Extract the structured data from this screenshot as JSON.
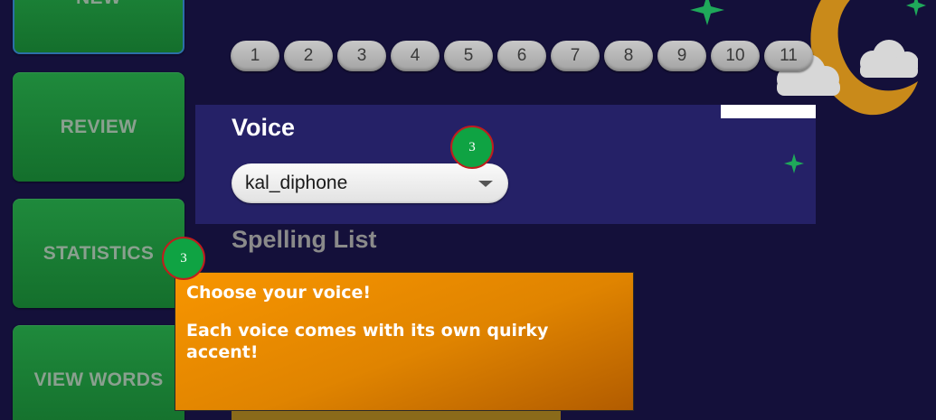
{
  "sidebar": {
    "items": [
      {
        "label": "NEW"
      },
      {
        "label": "REVIEW"
      },
      {
        "label": "STATISTICS"
      },
      {
        "label": "VIEW WORDS"
      }
    ]
  },
  "levels": [
    "1",
    "2",
    "3",
    "4",
    "5",
    "6",
    "7",
    "8",
    "9",
    "10",
    "11"
  ],
  "voice": {
    "title": "Voice",
    "selected": "kal_diphone"
  },
  "spelling_list": {
    "title": "Spelling List"
  },
  "tutorial": {
    "step_voice": "3",
    "step_sidebar": "3",
    "tooltip_heading": "Choose your voice!",
    "tooltip_body": "Each voice comes with its own quirky accent!"
  },
  "colors": {
    "background": "#14103a",
    "panel": "#252167",
    "nav_green": "#1f8a3c",
    "badge_green": "#0fa343",
    "tooltip_orange": "#f79500",
    "star_green": "#1fa85a",
    "moon": "#c98a1a"
  },
  "icons": {
    "dropdown": "chevron-down-icon",
    "moon": "moon-icon",
    "star": "star-icon",
    "cloud": "cloud-icon"
  }
}
